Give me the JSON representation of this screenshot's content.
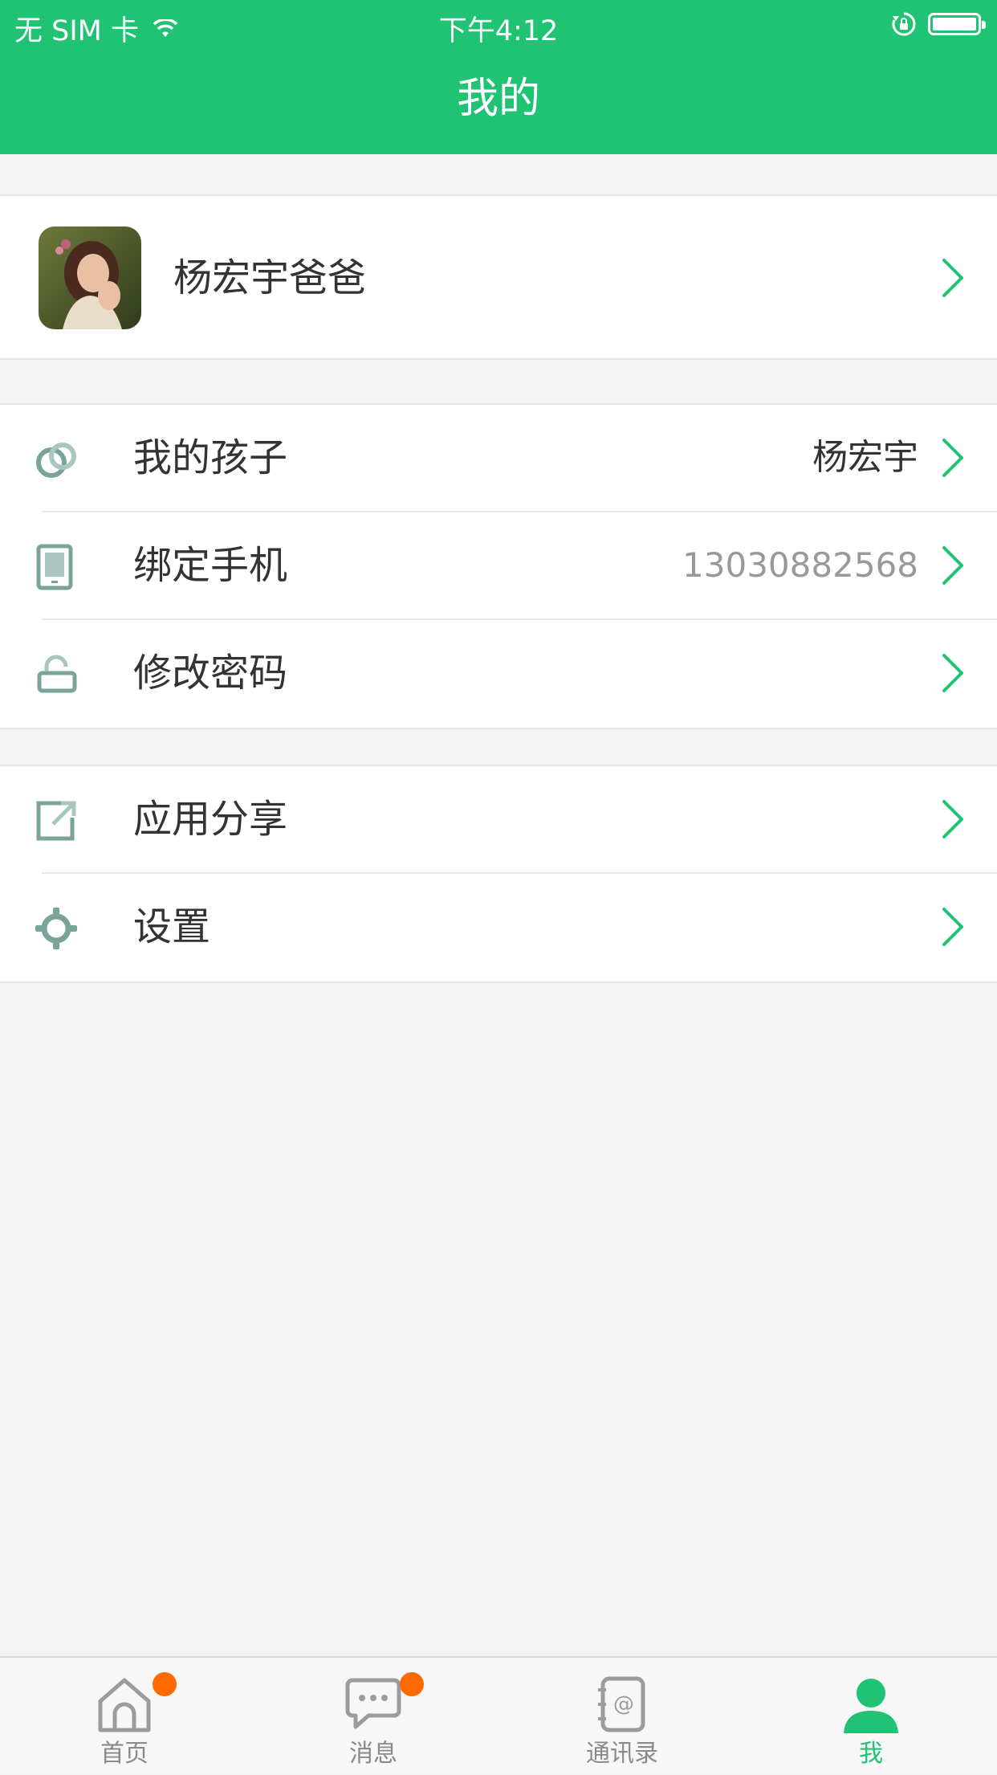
{
  "status_bar": {
    "carrier": "无 SIM 卡",
    "time": "下午4:12"
  },
  "header": {
    "title": "我的"
  },
  "profile": {
    "name": "杨宏宇爸爸"
  },
  "menu_group_1": [
    {
      "label": "我的孩子",
      "value": "杨宏宇",
      "icon": "children-icon"
    },
    {
      "label": "绑定手机",
      "value": "13030882568",
      "icon": "phone-icon"
    },
    {
      "label": "修改密码",
      "value": "",
      "icon": "lock-icon"
    }
  ],
  "menu_group_2": [
    {
      "label": "应用分享",
      "icon": "share-icon"
    },
    {
      "label": "设置",
      "icon": "gear-icon"
    }
  ],
  "tabbar": {
    "tabs": [
      {
        "label": "首页",
        "icon": "home-icon",
        "badge": true,
        "active": false
      },
      {
        "label": "消息",
        "icon": "message-icon",
        "badge": true,
        "active": false
      },
      {
        "label": "通讯录",
        "icon": "contacts-icon",
        "badge": false,
        "active": false
      },
      {
        "label": "我",
        "icon": "user-icon",
        "badge": false,
        "active": true
      }
    ]
  },
  "colors": {
    "brand_green": "#1fc373",
    "icon_gray_green": "#7aa39a",
    "badge_orange": "#ff6a00",
    "background": "#f3f3f3"
  }
}
